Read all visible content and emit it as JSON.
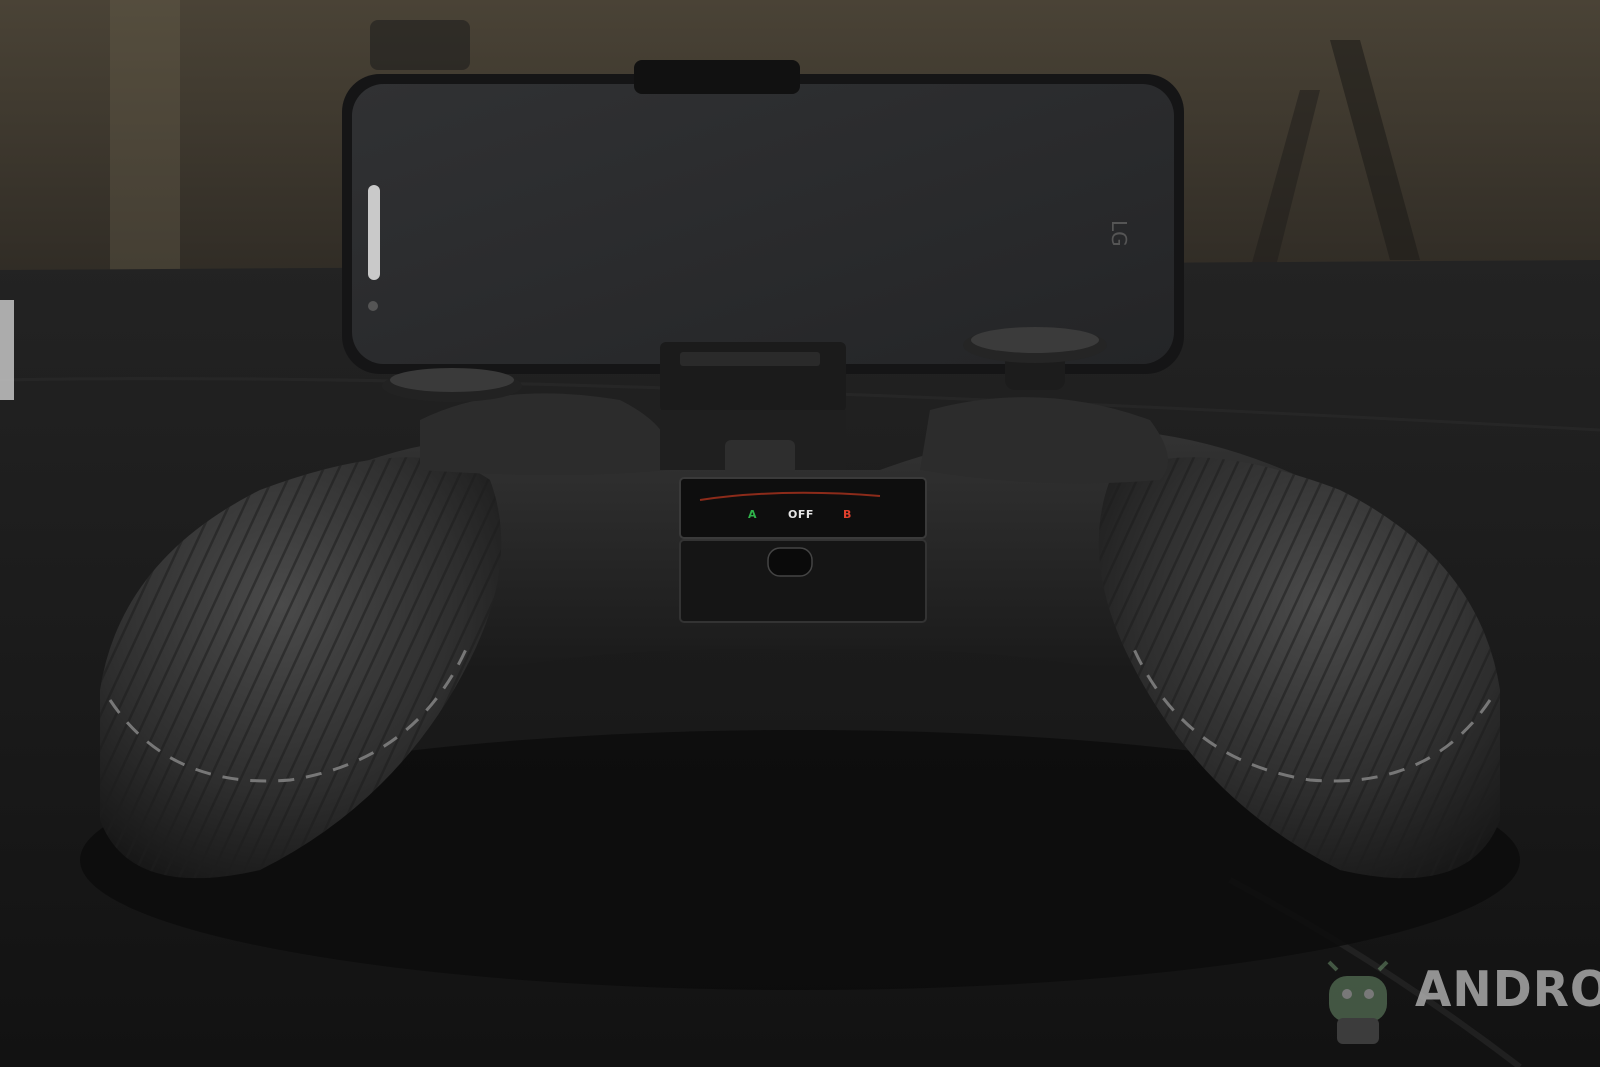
{
  "photo": {
    "subject": "game controller with phone mount",
    "switch_labels": {
      "a": "A",
      "off": "OFF",
      "b": "B"
    }
  },
  "watermark": {
    "text": "ANDROID",
    "icon": "android-robot-icon",
    "color": "#bdbdbd"
  },
  "colors": {
    "background": "#1a1a1a",
    "controller": "#262626",
    "grip": "#2b2b2b",
    "phone_screen": "#2a2b2d",
    "switch_a": "#2fb24a",
    "switch_b": "#e2402d"
  }
}
